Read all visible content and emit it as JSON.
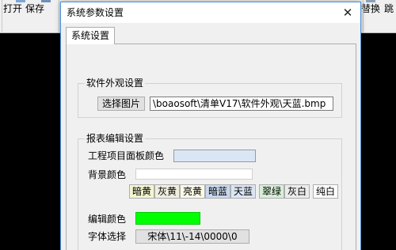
{
  "app_toolbar": {
    "items": [
      {
        "label": "打开"
      },
      {
        "label": "保存"
      },
      {
        "label": "替换"
      },
      {
        "label": "跳"
      }
    ]
  },
  "dialog": {
    "title": "系统参数设置",
    "close_glyph": "✕",
    "tab_label": "系统设置",
    "appearance": {
      "group_title": "软件外观设置",
      "select_image_label": "选择图片",
      "image_path": "\\boaosoft\\清单V17\\软件外观\\天蓝.bmp"
    },
    "report": {
      "group_title": "报表编辑设置",
      "panel_color_label": "工程项目面板颜色",
      "panel_color": "#dbe6f5",
      "bg_color_label": "背景颜色",
      "bg_color": "#ffffff",
      "color_buttons": [
        {
          "label": "暗黄",
          "bg": "#f4f4d0"
        },
        {
          "label": "灰黄",
          "bg": "#efefe0"
        },
        {
          "label": "亮黄",
          "bg": "#fafae8"
        },
        {
          "label": "暗蓝",
          "bg": "#c8d8ee"
        },
        {
          "label": "天蓝",
          "bg": "#dbe6f5"
        },
        {
          "label": "翠绿",
          "bg": "#d6efd6"
        },
        {
          "label": "灰白",
          "bg": "#ececec"
        },
        {
          "label": "纯白",
          "bg": "#ffffff"
        }
      ],
      "edit_color_label": "编辑颜色",
      "edit_color": "#00ff00",
      "font_label": "字体选择",
      "font_value": "宋体\\11\\-14\\0000\\0"
    }
  }
}
